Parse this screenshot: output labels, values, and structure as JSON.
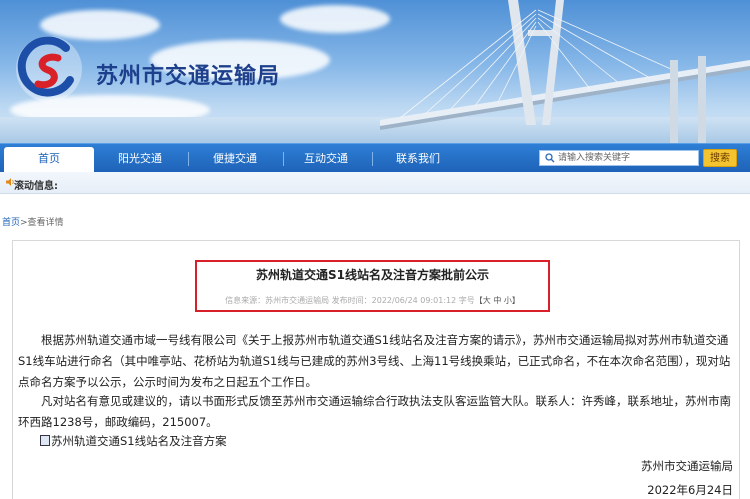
{
  "header": {
    "site_title": "苏州市交通运输局"
  },
  "nav": {
    "items": [
      {
        "label": "首页"
      },
      {
        "label": "阳光交通"
      },
      {
        "label": "便捷交通"
      },
      {
        "label": "互动交通"
      },
      {
        "label": "联系我们"
      }
    ],
    "search_placeholder": "请输入搜索关键字",
    "search_button": "搜索"
  },
  "scroll": {
    "label": "滚动信息:"
  },
  "breadcrumb": {
    "home": "首页",
    "current": ">查看详情"
  },
  "article": {
    "title": "苏州轨道交通S1线站名及注音方案批前公示",
    "meta_source": "信息来源：苏州市交通运输局 发布时间：2022/06/24 09:01:12  字号",
    "meta_fontsize": "【大 中 小】",
    "paragraph1": "根据苏州轨道交通市域一号线有限公司《关于上报苏州市轨道交通S1线站名及注音方案的请示》，苏州市交通运输局拟对苏州市轨道交通S1线车站进行命名（其中唯亭站、花桥站为轨道S1线与已建成的苏州3号线、上海11号线换乘站，已正式命名，不在本次命名范围），现对站点命名方案予以公示，公示时间为发布之日起五个工作日。",
    "paragraph2": "凡对站名有意见或建议的，请以书面形式反馈至苏州市交通运输综合行政执法支队客运监管大队。联系人：许秀峰，联系地址，苏州市南环西路1238号，邮政编码，215007。",
    "attachment": "苏州轨道交通S1线站名及注音方案",
    "sign_org": "苏州市交通运输局",
    "sign_date": "2022年6月24日"
  },
  "colors": {
    "nav_blue": "#1e63b8",
    "highlight_red": "#d8202a",
    "search_button": "#f4c430"
  }
}
